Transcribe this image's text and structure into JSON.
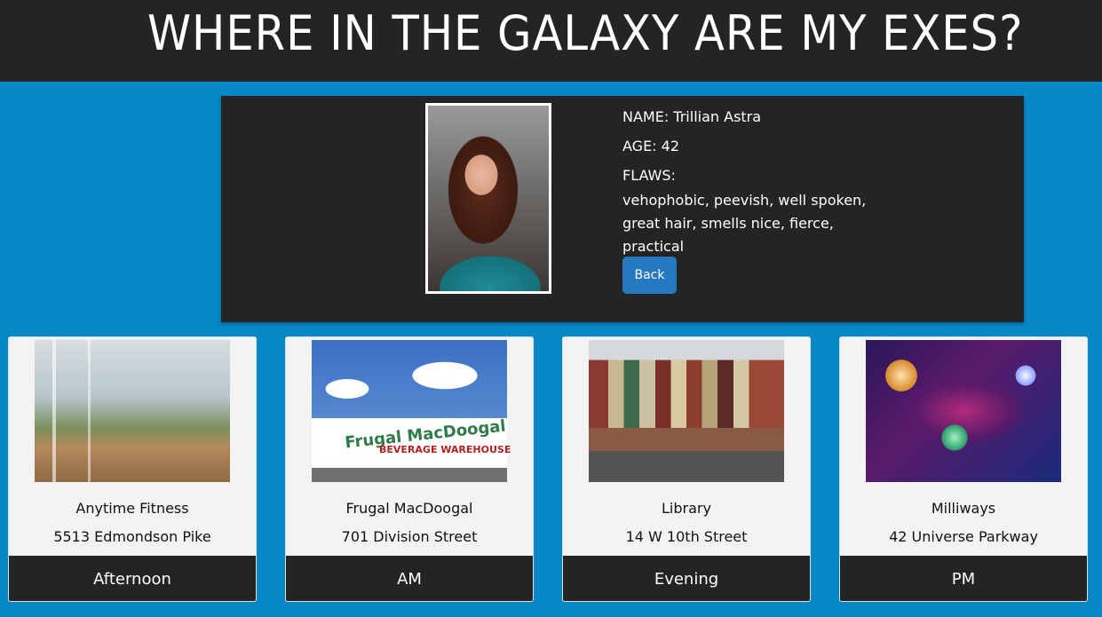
{
  "header": {
    "title": "WHERE IN THE GALAXY ARE MY EXES?"
  },
  "profile": {
    "name_label": "NAME: Trillian Astra",
    "age_label": "AGE: 42",
    "flaws_label": "FLAWS:",
    "flaws_text": "vehophobic, peevish, well spoken, great hair, smells nice, fierce, practical",
    "back_label": "Back"
  },
  "cards": [
    {
      "name": "Anytime Fitness",
      "address": "5513 Edmondson Pike",
      "time": "Afternoon"
    },
    {
      "name": "Frugal MacDoogal",
      "address": "701 Division Street",
      "time": "AM",
      "sign_text": "Frugal MacDoogal",
      "sign_sub": "BEVERAGE WAREHOUSE"
    },
    {
      "name": "Library",
      "address": "14 W 10th Street",
      "time": "Evening"
    },
    {
      "name": "Milliways",
      "address": "42 Universe Parkway",
      "time": "PM"
    }
  ],
  "colors": {
    "background": "#0688c7",
    "panel": "#242424",
    "button": "#2479c0",
    "card": "#f3f3f3"
  }
}
